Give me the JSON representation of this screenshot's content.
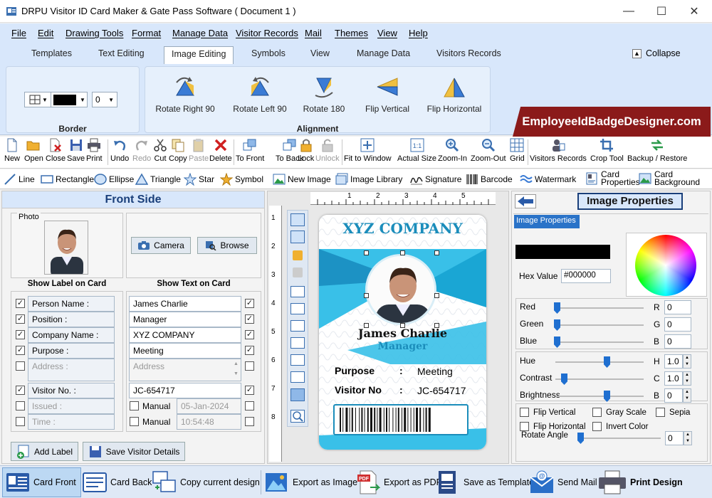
{
  "window": {
    "title": "DRPU Visitor ID Card Maker & Gate Pass Software ( Document 1 )",
    "minimize": "—",
    "maximize": "☐",
    "close": "✕"
  },
  "menu": [
    "File",
    "Edit",
    "Drawing Tools",
    "Format",
    "Manage Data",
    "Visitor Records",
    "Mail",
    "Themes",
    "View",
    "Help"
  ],
  "ribbon_tabs": {
    "items": [
      "Templates",
      "Text Editing",
      "Image Editing",
      "Symbols",
      "View",
      "Manage Data",
      "Visitors Records"
    ],
    "active": "Image Editing",
    "collapse": "Collapse"
  },
  "ribbon": {
    "border_group": "Border",
    "border_width_value": "0",
    "border_color": "#000000",
    "alignment_group": "Alignment",
    "buttons": [
      "Rotate Right 90",
      "Rotate Left 90",
      "Rotate 180",
      "Flip Vertical",
      "Flip Horizontal"
    ],
    "banner": "EmployeeIdBadgeDesigner.com"
  },
  "toolbar": [
    "New",
    "Open",
    "Close",
    "Save",
    "Print",
    "Undo",
    "Redo",
    "Cut",
    "Copy",
    "Paste",
    "Delete",
    "To Front",
    "To Back",
    "Lock",
    "Unlock",
    "Fit to Window",
    "Actual Size",
    "Zoom-In",
    "Zoom-Out",
    "Grid",
    "Visitors Records",
    "Crop Tool",
    "Backup / Restore"
  ],
  "drawbar": [
    "Line",
    "Rectangle",
    "Ellipse",
    "Triangle",
    "Star",
    "Symbol",
    "New Image",
    "Image Library",
    "Signature",
    "Barcode",
    "Watermark",
    "Card Properties",
    "Card Background"
  ],
  "left": {
    "header": "Front Side",
    "photo_label": "Photo",
    "camera": "Camera",
    "browse": "Browse",
    "show_label": "Show Label on Card",
    "show_text": "Show Text on Card",
    "rows": [
      {
        "label": "Person Name :",
        "value": "James Charlie",
        "lchk": true,
        "rchk": true,
        "enabled": true
      },
      {
        "label": "Position :",
        "value": "Manager",
        "lchk": true,
        "rchk": true,
        "enabled": true
      },
      {
        "label": "Company Name :",
        "value": "XYZ COMPANY",
        "lchk": true,
        "rchk": true,
        "enabled": true
      },
      {
        "label": "Purpose :",
        "value": "Meeting",
        "lchk": true,
        "rchk": true,
        "enabled": true
      },
      {
        "label": "Address :",
        "value": "Address",
        "lchk": false,
        "rchk": false,
        "enabled": false
      },
      {
        "label": "Visitor No. :",
        "value": "JC-654717",
        "lchk": true,
        "rchk": true,
        "enabled": true
      },
      {
        "label": "Issued :",
        "value": "05-Jan-2024",
        "lchk": false,
        "rchk": false,
        "enabled": false,
        "manual": "Manual"
      },
      {
        "label": "Time :",
        "value": "10:54:48",
        "lchk": false,
        "rchk": false,
        "enabled": false,
        "manual": "Manual"
      }
    ],
    "add_label": "Add Label",
    "save_details": "Save Visitor Details"
  },
  "card": {
    "company": "XYZ COMPANY",
    "name": "James Charlie",
    "position": "Manager",
    "purpose_label": "Purpose",
    "purpose_value": "Meeting",
    "visitor_label": "Visitor No",
    "visitor_value": "JC-654717",
    "sep": ":",
    "ruler_h": [
      "1",
      "2",
      "3",
      "4",
      "5"
    ],
    "ruler_v": [
      "1",
      "2",
      "3",
      "4",
      "5",
      "6",
      "7",
      "8"
    ]
  },
  "right": {
    "header": "Image Properties",
    "tab": "Image Properties",
    "hex_label": "Hex Value",
    "hex_value": "#000000",
    "color_swatch": "#000000",
    "rgb": [
      {
        "name": "Red",
        "key": "R",
        "value": "0"
      },
      {
        "name": "Green",
        "key": "G",
        "value": "0"
      },
      {
        "name": "Blue",
        "key": "B",
        "value": "0"
      }
    ],
    "hcb": [
      {
        "name": "Hue",
        "key": "H",
        "value": "1.0"
      },
      {
        "name": "Contrast",
        "key": "C",
        "value": "1.0"
      },
      {
        "name": "Brightness",
        "key": "B",
        "value": "0"
      }
    ],
    "checks": [
      "Flip Vertical",
      "Gray Scale",
      "Sepia",
      "Flip Horizontal",
      "Invert Color"
    ],
    "rotate_label": "Rotate Angle",
    "rotate_value": "0"
  },
  "bottom": [
    "Card Front",
    "Card Back",
    "Copy current design",
    "Export as Image",
    "Export as PDF",
    "Save as Template",
    "Send Mail",
    "Print Design"
  ]
}
